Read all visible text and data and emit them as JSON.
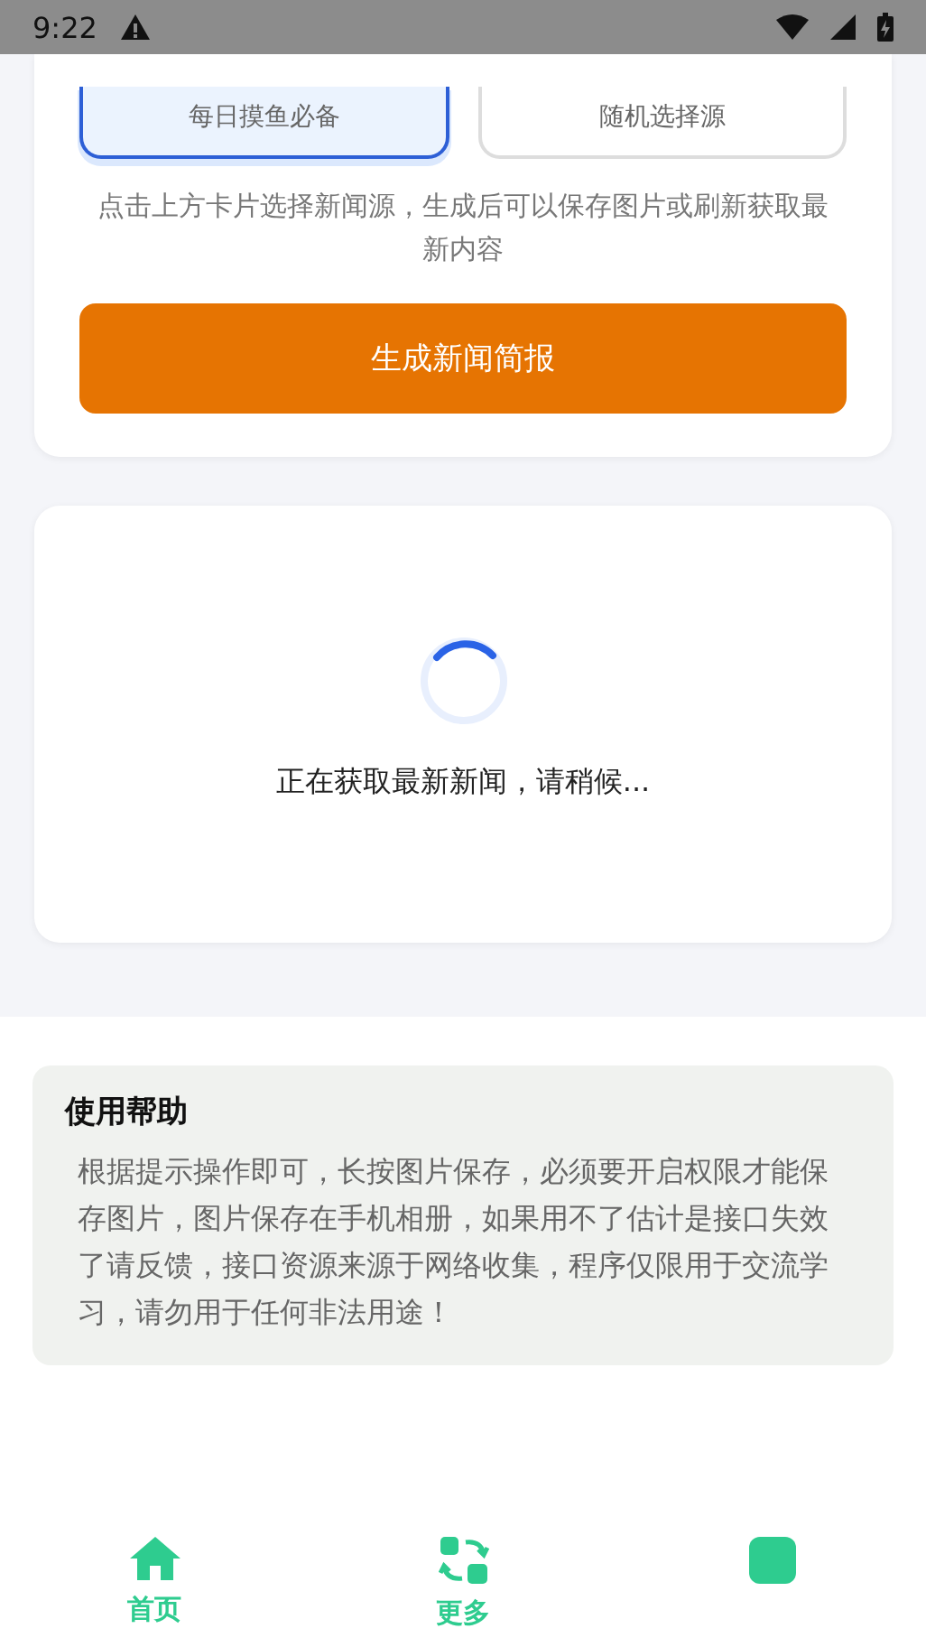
{
  "status_bar": {
    "time": "9:22"
  },
  "source_options": [
    {
      "label": "每日摸鱼必备",
      "selected": true
    },
    {
      "label": "随机选择源",
      "selected": false
    }
  ],
  "hint": "点击上方卡片选择新闻源，生成后可以保存图片或刷新获取最新内容",
  "generate_button": "生成新闻简报",
  "loading": {
    "message": "正在获取最新新闻，请稍候..."
  },
  "help": {
    "title": "使用帮助",
    "body": "根据提示操作即可，长按图片保存，必须要开启权限才能保存图片，图片保存在手机相册，如果用不了估计是接口失效了请反馈，接口资源来源于网络收集，程序仅限用于交流学习，请勿用于任何非法用途！"
  },
  "bottom_nav": [
    {
      "kind": "home",
      "label": "首页"
    },
    {
      "kind": "more",
      "label": "更多"
    },
    {
      "kind": "about"
    }
  ]
}
